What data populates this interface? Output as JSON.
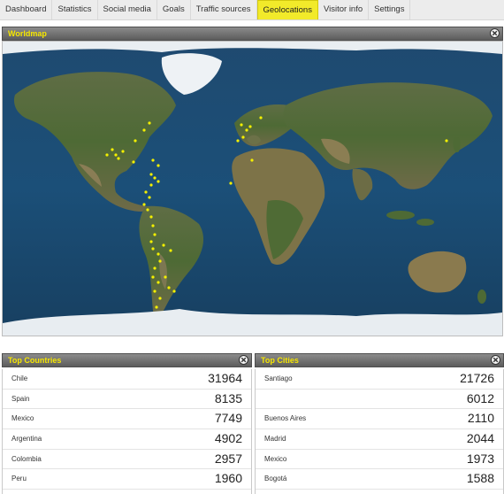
{
  "nav": {
    "items": [
      {
        "label": "Dashboard",
        "active": false
      },
      {
        "label": "Statistics",
        "active": false
      },
      {
        "label": "Social media",
        "active": false
      },
      {
        "label": "Goals",
        "active": false
      },
      {
        "label": "Traffic sources",
        "active": false
      },
      {
        "label": "Geolocations",
        "active": true
      },
      {
        "label": "Visitor info",
        "active": false
      },
      {
        "label": "Settings",
        "active": false
      }
    ]
  },
  "worldmap": {
    "title": "Worldmap",
    "marker_color": "#f4f000"
  },
  "top_countries": {
    "title": "Top Countries",
    "rows": [
      {
        "name": "Chile",
        "value": "31964"
      },
      {
        "name": "Spain",
        "value": "8135"
      },
      {
        "name": "Mexico",
        "value": "7749"
      },
      {
        "name": "Argentina",
        "value": "4902"
      },
      {
        "name": "Colombia",
        "value": "2957"
      },
      {
        "name": "Peru",
        "value": "1960"
      }
    ]
  },
  "top_cities": {
    "title": "Top Cities",
    "rows": [
      {
        "name": "Santiago",
        "value": "21726"
      },
      {
        "name": "",
        "value": "6012"
      },
      {
        "name": "Buenos Aires",
        "value": "2110"
      },
      {
        "name": "Madrid",
        "value": "2044"
      },
      {
        "name": "Mexico",
        "value": "1973"
      },
      {
        "name": "Bogotá",
        "value": "1588"
      }
    ]
  }
}
